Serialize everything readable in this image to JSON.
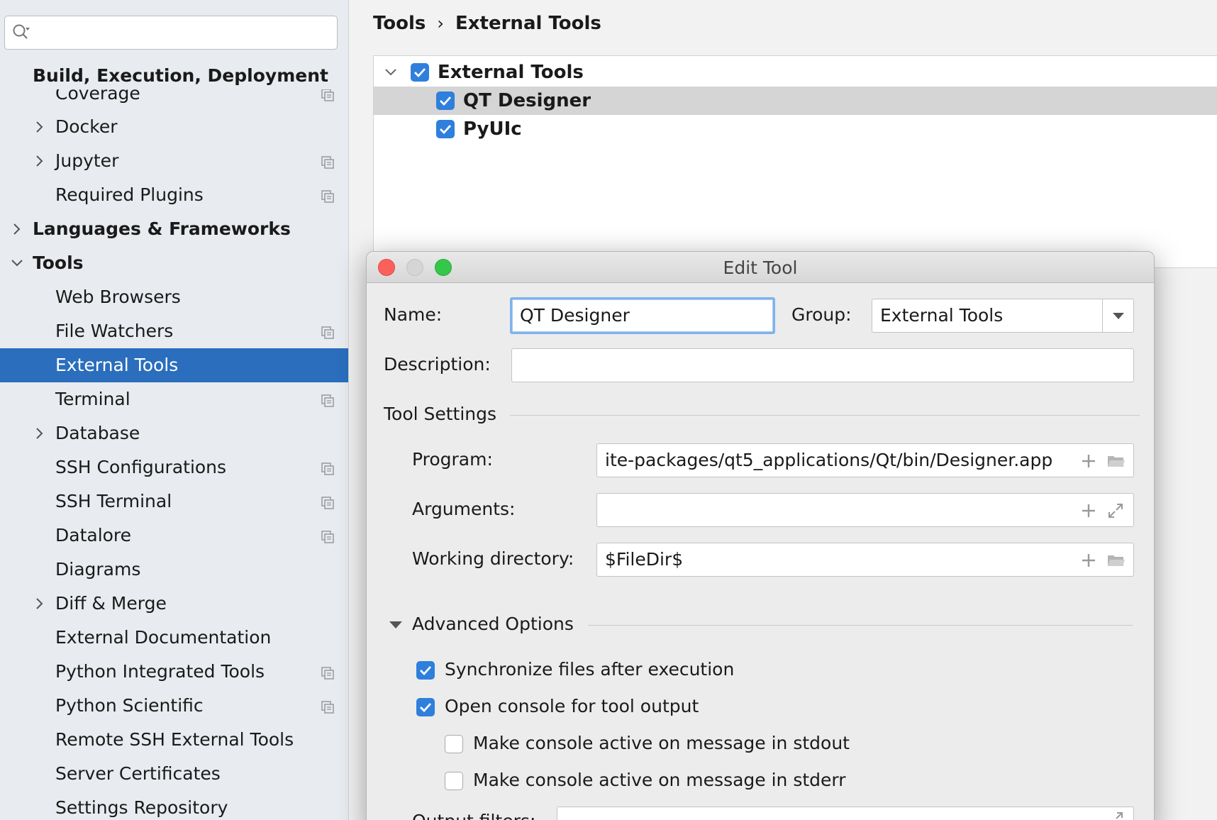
{
  "sidebar": {
    "search": {
      "value": "",
      "placeholder": ""
    },
    "header": "Build, Execution, Deployment",
    "items": [
      {
        "label": "Coverage"
      },
      {
        "label": "Docker"
      },
      {
        "label": "Jupyter"
      },
      {
        "label": "Required Plugins"
      },
      {
        "label": "Languages & Frameworks"
      },
      {
        "label": "Tools"
      },
      {
        "label": "Web Browsers"
      },
      {
        "label": "File Watchers"
      },
      {
        "label": "External Tools"
      },
      {
        "label": "Terminal"
      },
      {
        "label": "Database"
      },
      {
        "label": "SSH Configurations"
      },
      {
        "label": "SSH Terminal"
      },
      {
        "label": "Datalore"
      },
      {
        "label": "Diagrams"
      },
      {
        "label": "Diff & Merge"
      },
      {
        "label": "External Documentation"
      },
      {
        "label": "Python Integrated Tools"
      },
      {
        "label": "Python Scientific"
      },
      {
        "label": "Remote SSH External Tools"
      },
      {
        "label": "Server Certificates"
      },
      {
        "label": "Settings Repository"
      }
    ]
  },
  "breadcrumb": {
    "parent": "Tools",
    "current": "External Tools"
  },
  "tree": {
    "group": {
      "label": "External Tools",
      "checked": true,
      "expanded": true
    },
    "tools": [
      {
        "label": "QT Designer",
        "checked": true,
        "selected": true
      },
      {
        "label": "PyUIc",
        "checked": true,
        "selected": false
      }
    ]
  },
  "dialog": {
    "title": "Edit Tool",
    "name_label": "Name:",
    "name_value": "QT Designer",
    "group_label": "Group:",
    "group_value": "External Tools",
    "description_label": "Description:",
    "description_value": "",
    "tool_settings_label": "Tool Settings",
    "program_label": "Program:",
    "program_value": "ite-packages/qt5_applications/Qt/bin/Designer.app",
    "arguments_label": "Arguments:",
    "arguments_value": "",
    "working_dir_label": "Working directory:",
    "working_dir_value": "$FileDir$",
    "advanced_label": "Advanced Options",
    "options": [
      {
        "label": "Synchronize files after execution",
        "checked": true
      },
      {
        "label": "Open console for tool output",
        "checked": true
      },
      {
        "label": "Make console active on message in stdout",
        "checked": false
      },
      {
        "label": "Make console active on message in stderr",
        "checked": false
      }
    ],
    "output_filters_label": "Output filters:"
  },
  "colors": {
    "accent": "#2a6ebd",
    "checkbox": "#2f7fdc",
    "sidebar_bg": "#e8ebef"
  }
}
